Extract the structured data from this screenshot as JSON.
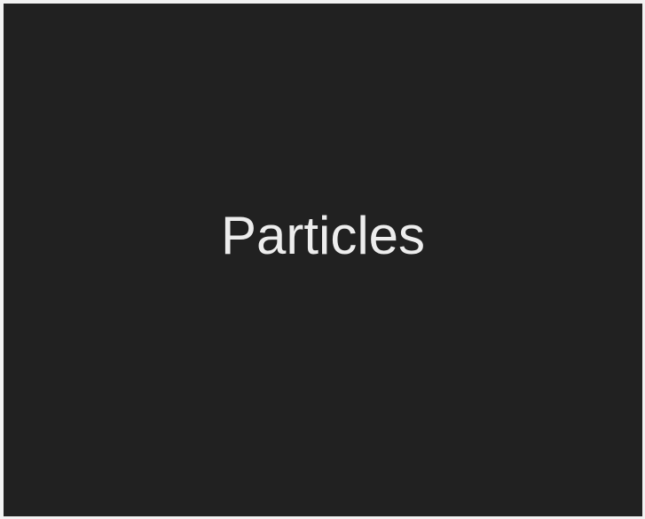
{
  "scene": {
    "title": "Particles"
  },
  "colors": {
    "frame": "#f2f2f2",
    "canvas": "#212121",
    "text": "#ededed"
  }
}
